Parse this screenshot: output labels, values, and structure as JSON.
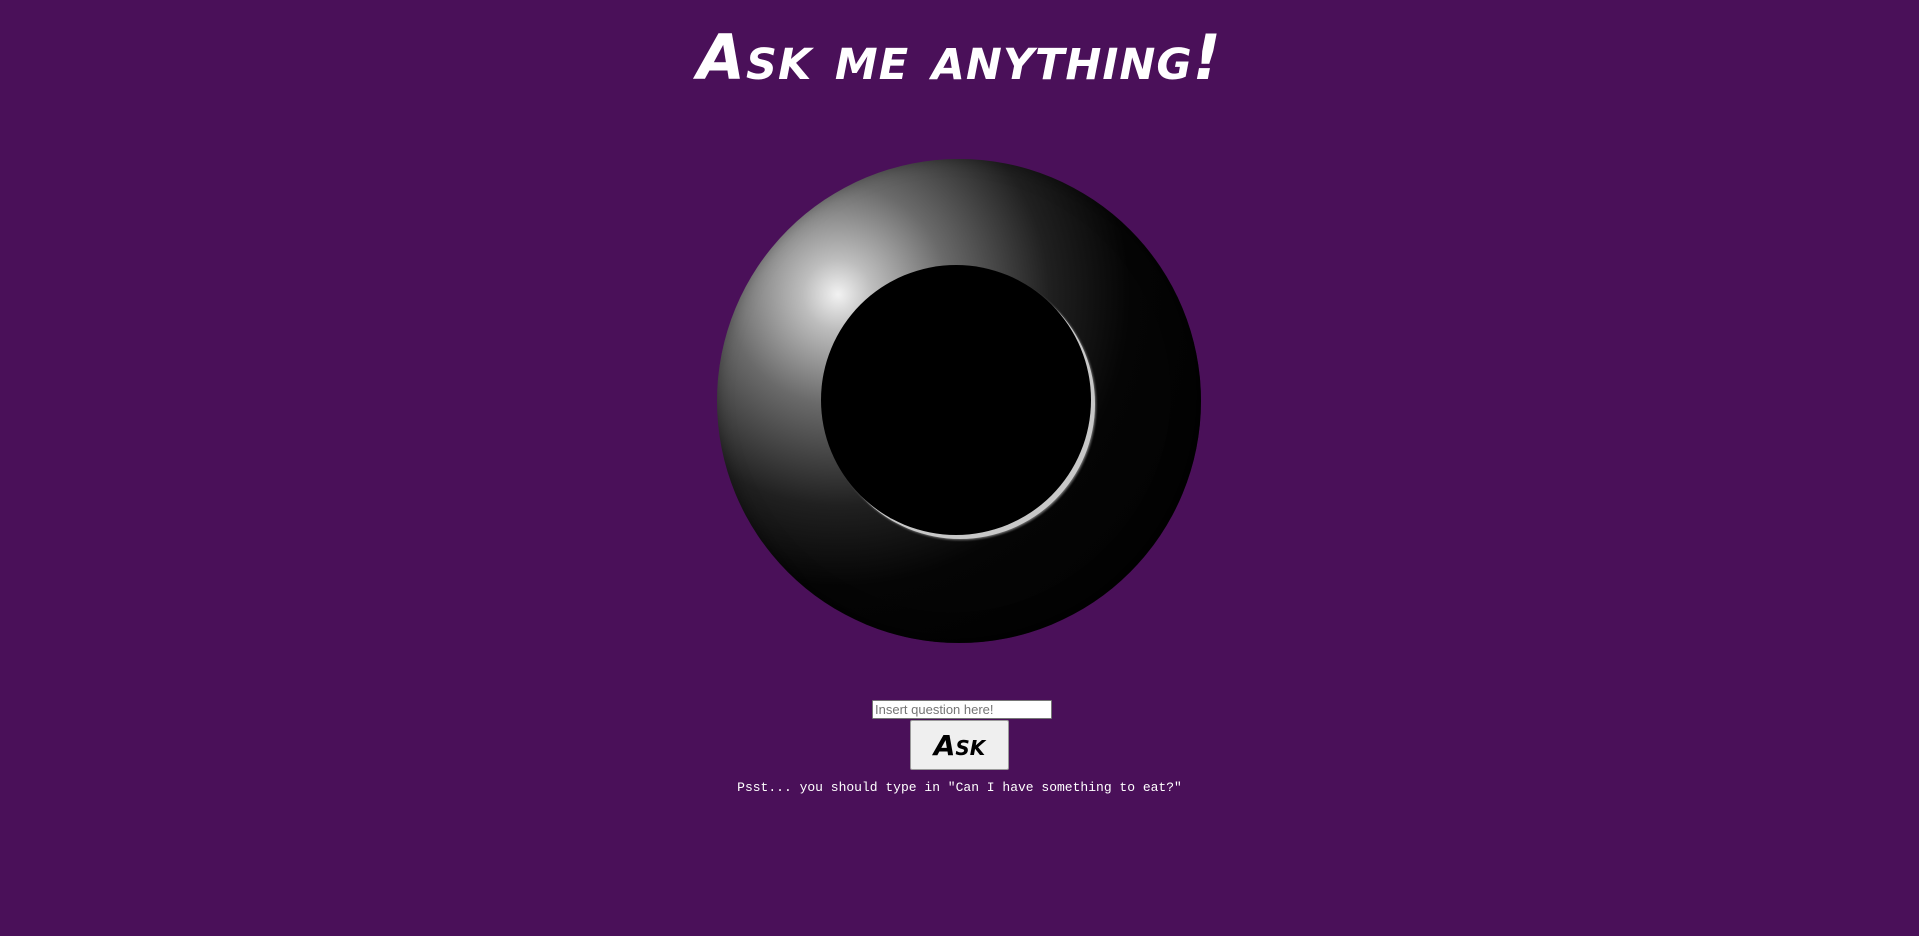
{
  "page": {
    "title": "Ask me anything!",
    "background_color": "#4a1059"
  },
  "ball": {
    "answer": ""
  },
  "form": {
    "question_placeholder": "Insert question here!",
    "question_value": "",
    "ask_label": "Ask"
  },
  "hint": {
    "text": "Psst... you should type in \"Can I have something to eat?\""
  }
}
